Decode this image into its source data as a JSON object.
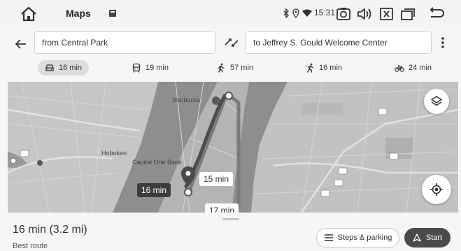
{
  "status_bar": {
    "title": "Maps",
    "time": "15:31",
    "icons": [
      "home-icon",
      "app-square-icon",
      "bluetooth-icon",
      "location-icon",
      "wifi-icon",
      "screenshot-icon",
      "volume-icon",
      "close-box-icon",
      "recents-icon",
      "back-icon"
    ]
  },
  "directions": {
    "from_value": "from Central Park",
    "to_value": "to Jeffrey S. Gould Welcome Center"
  },
  "modes": [
    {
      "name": "drive",
      "label": "16 min",
      "icon": "car-icon",
      "active": true
    },
    {
      "name": "transit",
      "label": "19 min",
      "icon": "transit-icon",
      "active": false
    },
    {
      "name": "walk",
      "label": "57 min",
      "icon": "walk-icon",
      "active": false
    },
    {
      "name": "ride",
      "label": "16 min",
      "icon": "ride-icon",
      "active": false
    },
    {
      "name": "bike",
      "label": "24 min",
      "icon": "bike-icon",
      "active": false
    }
  ],
  "map": {
    "labels": {
      "starbucks": "Starbucks",
      "hoboken": "Hoboken",
      "capital_one": "Capital One Bank"
    },
    "route_times": {
      "selected": "16 min",
      "alt1": "15 min",
      "alt2": "17 min"
    }
  },
  "sheet": {
    "summary": "16 min (3.2 mi)",
    "subtitle": "Best route",
    "steps_label": "Steps & parking",
    "start_label": "Start"
  },
  "colors": {
    "accent_dark": "#4a4a4a",
    "water": "#8e8e8e",
    "route": "#555555"
  }
}
